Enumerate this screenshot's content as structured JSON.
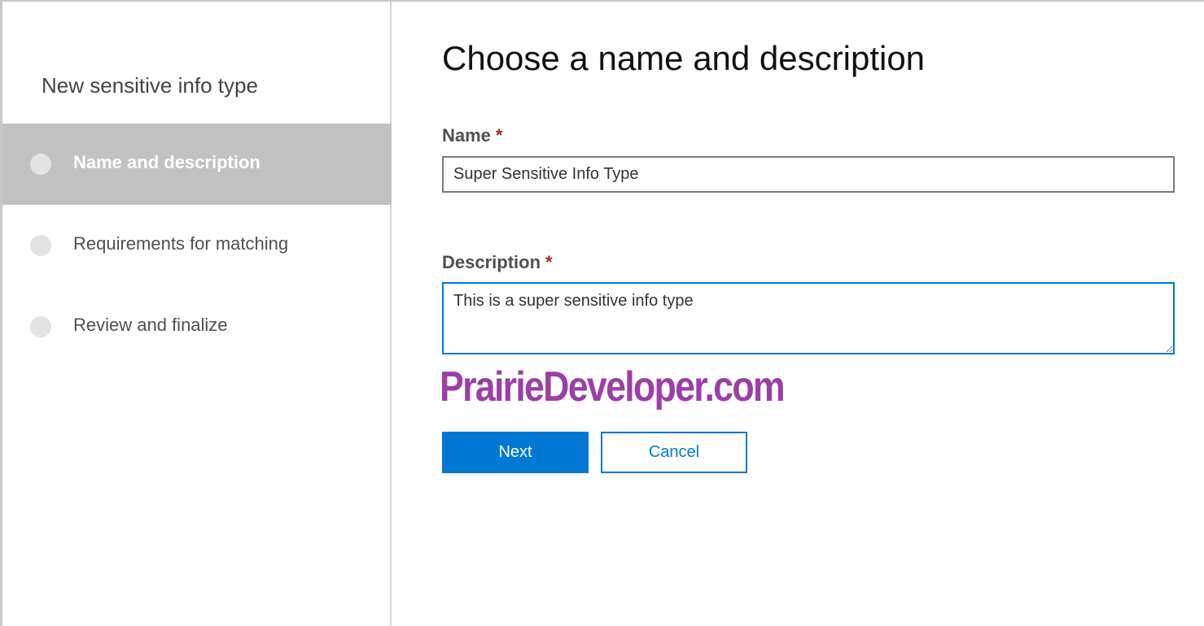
{
  "wizard": {
    "title": "New sensitive info type",
    "steps": [
      {
        "label": "Name and description",
        "active": true
      },
      {
        "label": "Requirements for matching",
        "active": false
      },
      {
        "label": "Review and finalize",
        "active": false
      }
    ]
  },
  "main": {
    "title": "Choose a name and description",
    "name_field": {
      "label": "Name",
      "required_marker": "*",
      "value": "Super Sensitive Info Type"
    },
    "description_field": {
      "label": "Description",
      "required_marker": "*",
      "value": "This is a super sensitive info type"
    },
    "watermark": "PrairieDeveloper.com",
    "buttons": {
      "next_label": "Next",
      "cancel_label": "Cancel"
    }
  },
  "colors": {
    "accent": "#0078d4",
    "active_step_bg": "#c2c2c2",
    "required": "#a4262c",
    "watermark": "#9b3fa7"
  }
}
